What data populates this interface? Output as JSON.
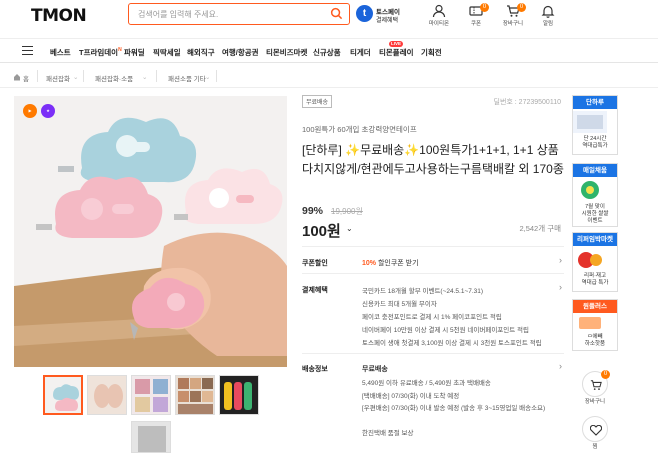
{
  "header": {
    "logo": "TMON",
    "search_placeholder": "검색어를 입력해 주세요.",
    "tosspay_line1": "토스페이",
    "tosspay_line2": "결제혜택",
    "icons": [
      {
        "label": "마이티몬",
        "icon": "user-icon"
      },
      {
        "label": "쿠폰",
        "icon": "coupon-icon",
        "badge": "0"
      },
      {
        "label": "장바구니",
        "icon": "cart-icon",
        "badge": "0"
      },
      {
        "label": "알림",
        "icon": "bell-icon"
      }
    ]
  },
  "nav": {
    "items": [
      "베스트",
      "T프라임데이",
      "파워딜",
      "픽딱세일",
      "해외직구",
      "여행/항공권",
      "티몬비즈마켓",
      "신규상품",
      "티게더",
      "티몬플레이",
      "기획전"
    ],
    "new_mark": "N",
    "live_badge": "LIVE"
  },
  "breadcrumb": [
    "홈",
    "패션잡화",
    "패션잡화·소품",
    "패션소품 기타"
  ],
  "product": {
    "tag": "무료배송",
    "product_no": "딜번호 : 27239500110",
    "subtitle": "100원특가 60개입 초강력양면테이프",
    "title": "[단하루] ✨무료배송✨100원특가1+1+1, 1+1 상품다치지않게/현관에두고사용하는구름택배칼 외 170종",
    "discount": "99%",
    "original_price": "19,900원",
    "price": "100원",
    "sold": "2,542개 구매",
    "coupon_label": "쿠폰할인",
    "coupon_pct": "10%",
    "coupon_text": "할인쿠폰 받기",
    "card_label": "결제혜택",
    "card_lines": [
      "국민카드 18개월 할부 이벤트(~24.5.1~7.31)",
      "신용카드 최대 5개월 무이자",
      "페이코 충전포인트로 결제 시 1% 페이코포인트 적립",
      "네이버페이 10만원 이상 결제 시 5천원 네이버페이포인트 적립",
      "토스페이 생애 첫결제 3,100원 이상 결제 시 3천원 토스포인트 적립"
    ],
    "ship_label": "배송정보",
    "ship_title": "무료배송",
    "ship_lines": [
      "5,490원 이하 유료배송 / 5,490원 초과 택배배송",
      "[택배배송] 07/30(화) 이내 도착 예정",
      "[우편배송] 07/30(화) 이내 발송 예정 (발송 후 3~15영업일 배송소요)",
      "한진택배    품절 보상"
    ]
  },
  "sidebar": {
    "boxes": [
      {
        "title": "단하루",
        "caption": "단 24시간\n역대급특가",
        "color": "#1b74e4"
      },
      {
        "title": "매일채움",
        "caption": "7월 맞이\n시원한 쌀쌀\n이벤트",
        "color": "#1b74e4"
      },
      {
        "title": "리퍼임박마켓",
        "caption": "리퍼·재고\n역대급 특가",
        "color": "#1b74e4"
      },
      {
        "title": "원플러스",
        "caption": "ㅁ에빼\n하소핫품",
        "color": "#ff5a1f"
      }
    ],
    "cart_label": "장바구니",
    "cart_badge": "0",
    "wish_label": "찜"
  }
}
